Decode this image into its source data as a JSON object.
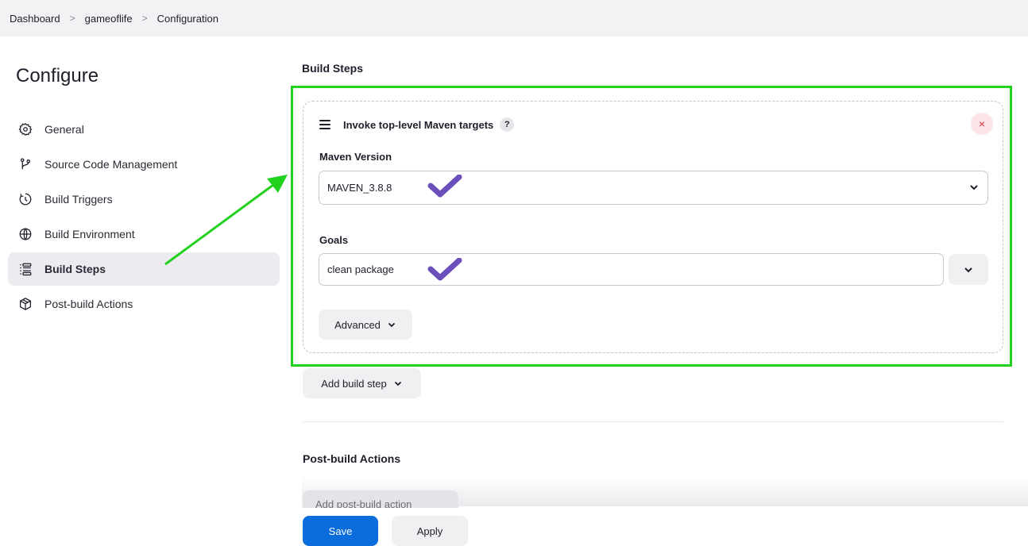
{
  "breadcrumb": [
    "Dashboard",
    "gameoflife",
    "Configuration"
  ],
  "breadcrumb_separator": ">",
  "page_title": "Configure",
  "sidebar": {
    "items": [
      {
        "label": "General",
        "icon": "gear-icon",
        "active": false
      },
      {
        "label": "Source Code Management",
        "icon": "branch-icon",
        "active": false
      },
      {
        "label": "Build Triggers",
        "icon": "timer-icon",
        "active": false
      },
      {
        "label": "Build Environment",
        "icon": "globe-icon",
        "active": false
      },
      {
        "label": "Build Steps",
        "icon": "list-icon",
        "active": true
      },
      {
        "label": "Post-build Actions",
        "icon": "package-icon",
        "active": false
      }
    ]
  },
  "build_steps": {
    "heading": "Build Steps",
    "step": {
      "title": "Invoke top-level Maven targets",
      "help": "?",
      "close": "×",
      "maven_version_label": "Maven Version",
      "maven_version_value": "MAVEN_3.8.8",
      "goals_label": "Goals",
      "goals_value": "clean package",
      "advanced_label": "Advanced"
    },
    "add_step_label": "Add build step"
  },
  "post_build": {
    "heading": "Post-build Actions",
    "add_action_label": "Add post-build action"
  },
  "footer": {
    "save_label": "Save",
    "apply_label": "Apply"
  },
  "colors": {
    "highlight": "#22d11e",
    "save": "#0b6cdc",
    "check": "#6b4fbb"
  }
}
